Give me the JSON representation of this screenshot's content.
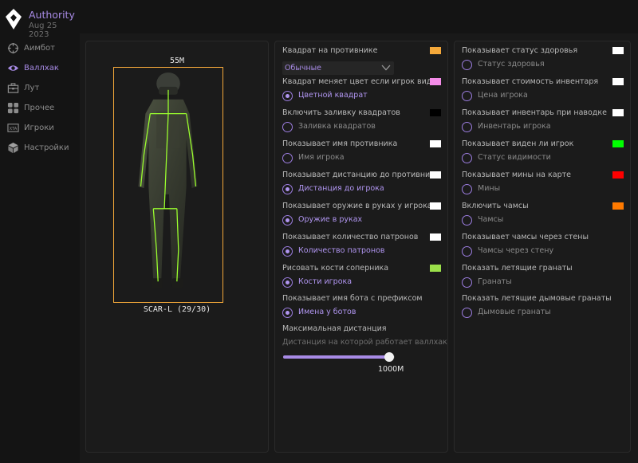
{
  "app": {
    "title": "Authority",
    "date": "Aug 25 2023"
  },
  "sidebar": {
    "items": [
      {
        "label": "Аимбот",
        "icon": "crosshair-icon",
        "active": false
      },
      {
        "label": "Валлхак",
        "icon": "eye-icon",
        "active": true
      },
      {
        "label": "Лут",
        "icon": "toolbox-icon",
        "active": false
      },
      {
        "label": "Прочее",
        "icon": "grid-icon",
        "active": false
      },
      {
        "label": "Игроки",
        "icon": "xta-icon",
        "active": false
      },
      {
        "label": "Настройки",
        "icon": "cube-icon",
        "active": false
      }
    ]
  },
  "preview": {
    "distance": "55M",
    "weapon": "SCAR-L (29/30)",
    "box_color": "#f4a83a",
    "skeleton_color": "#9bff2e"
  },
  "column2": {
    "box": {
      "title": "Квадрат на противнике",
      "select": "Обычные",
      "color": "#f4a83a"
    },
    "color_change": {
      "title": "Квадрат меняет цвет если игрок виден",
      "label": "Цветной квадрат",
      "on": true,
      "color": "#f48ce8"
    },
    "fill": {
      "title": "Включить заливку квадратов",
      "label": "Заливка квадратов",
      "on": false,
      "color": "#000000"
    },
    "name": {
      "title": "Показывает имя противника",
      "label": "Имя игрока",
      "on": false,
      "color": "#ffffff"
    },
    "distance": {
      "title": "Показывает дистанцию до противника",
      "label": "Дистанция до игрока",
      "on": true,
      "color": "#ffffff"
    },
    "weapon": {
      "title": "Показывает оружие в руках у игрока",
      "label": "Оружие в руках",
      "on": true,
      "color": "#ffffff"
    },
    "ammo": {
      "title": "Показывает количество патронов",
      "label": "Количество патронов",
      "on": true,
      "color": "#ffffff"
    },
    "bones": {
      "title": "Рисовать кости соперника",
      "label": "Кости игрока",
      "on": true,
      "color": "#9be04a"
    },
    "bot_names": {
      "title": "Показывает имя бота с префиксом",
      "label": "Имена у ботов",
      "on": true
    },
    "max_distance": {
      "title": "Максимальная дистанция",
      "subtitle": "Дистанция на которой работает валлхак",
      "value_text": "1000M",
      "fraction": 0.95
    }
  },
  "column3": {
    "health": {
      "title": "Показывает статус здоровья",
      "label": "Статус здоровья",
      "on": false,
      "color": "#ffffff"
    },
    "inv_value": {
      "title": "Показывает стоимость инвентаря",
      "label": "Цена игрока",
      "on": false,
      "color": "#ffffff"
    },
    "inv_hover": {
      "title": "Показывает инвентарь при наводке",
      "label": "Инвентарь игрока",
      "on": false,
      "color": "#ffffff"
    },
    "visible": {
      "title": "Показывает виден ли игрок",
      "label": "Статус видимости",
      "on": false,
      "color": "#00ff00"
    },
    "mines": {
      "title": "Показывает мины на карте",
      "label": "Мины",
      "on": false,
      "color": "#ff0000"
    },
    "chams": {
      "title": "Включить чамсы",
      "label": "Чамсы",
      "on": false,
      "color": "#ff7a00"
    },
    "chams_walls": {
      "title": "Показывает чамсы через стены",
      "label": "Чамсы через стену",
      "on": false
    },
    "grenades": {
      "title": "Показать летящие гранаты",
      "label": "Гранаты",
      "on": false
    },
    "smoke": {
      "title": "Показать летящие дымовые гранаты",
      "label": "Дымовые гранаты",
      "on": false
    }
  }
}
